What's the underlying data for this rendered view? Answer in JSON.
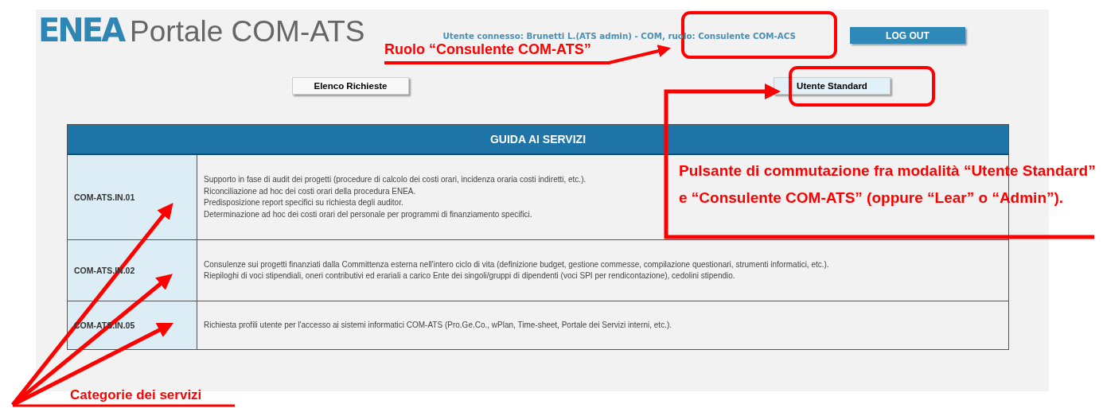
{
  "header": {
    "logo": "ENEA",
    "title": "Portale COM-ATS",
    "user_info": "Utente connesso: Brunetti L.(ATS admin) - COM, ruolo: Consulente COM-ACS",
    "logout_button": "LOG OUT"
  },
  "requests_button": "Elenco Richieste",
  "mode_button": "Utente Standard",
  "guide": {
    "title": "GUIDA AI SERVIZI",
    "rows": [
      {
        "code": "COM-ATS.IN.01",
        "lines": [
          "Supporto in fase di audit dei progetti (procedure di calcolo dei costi orari, incidenza oraria costi indiretti, etc.).",
          "Riconciliazione ad hoc dei costi orari della procedura ENEA.",
          "Predisposizione report specifici su richiesta degli auditor.",
          "Determinazione ad hoc dei costi orari del personale per programmi di finanziamento specifici."
        ]
      },
      {
        "code": "COM-ATS.IN.02",
        "lines": [
          "Consulenze sui progetti finanziati dalla Committenza esterna nell'intero ciclo di vita (definizione budget, gestione commesse, compilazione questionari, strumenti informatici, etc.).",
          "Riepiloghi di voci stipendiali, oneri contributivi ed erariali a carico Ente dei singoli/gruppi di dipendenti (voci SPI per rendicontazione), cedolini stipendio."
        ]
      },
      {
        "code": "COM-ATS.IN.05",
        "lines": [
          "Richiesta profili utente per l'accesso ai sistemi informatici COM-ATS (Pro.Ge.Co., wPlan, Time-sheet, Portale dei Servizi interni, etc.)."
        ]
      }
    ]
  },
  "annotations": {
    "role_note": "Ruolo “Consulente COM-ATS”",
    "switch_note": "Pulsante di commutazione fra modalità “Utente Standard” e “Consulente COM-ATS” (oppure “Lear” o “Admin”).",
    "categories_note": "Categorie dei servizi"
  }
}
